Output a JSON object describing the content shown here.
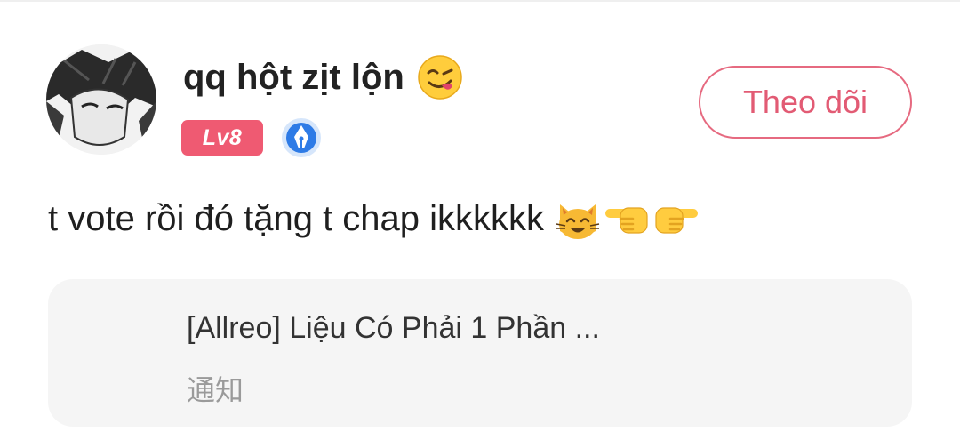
{
  "user": {
    "name": "qq hột zịt lộn",
    "name_emoji": "face-savoring-food-emoji",
    "level_label": "Lv8",
    "badge_icon": "fountain-pen-badge-icon"
  },
  "follow_button": {
    "label": "Theo dõi",
    "color": "#e25b74"
  },
  "comment": {
    "text": "t vote rồi đó tặng t chap ikkkkkk",
    "emojis": [
      "smiling-cat-emoji",
      "backhand-index-pointing-left-emoji",
      "backhand-index-pointing-right-emoji"
    ]
  },
  "linked_card": {
    "title": "[Allreo] Liệu Có Phải 1 Phần ...",
    "subtitle": "通知"
  },
  "colors": {
    "accent": "#ef5a72",
    "card_background": "#f5f5f5",
    "badge_blue": "#2e7be6"
  }
}
